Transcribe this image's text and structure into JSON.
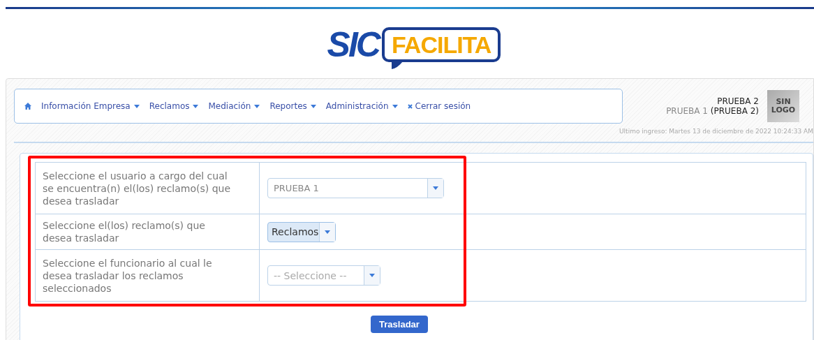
{
  "logo": {
    "left": "SIC",
    "right": "FACILITA"
  },
  "nav": {
    "items": [
      {
        "label": "Información Empresa",
        "kind": "dropdown"
      },
      {
        "label": "Reclamos",
        "kind": "dropdown"
      },
      {
        "label": "Mediación",
        "kind": "dropdown"
      },
      {
        "label": "Reportes",
        "kind": "dropdown"
      },
      {
        "label": "Administración",
        "kind": "dropdown"
      },
      {
        "label": "Cerrar sesión",
        "kind": "logout"
      }
    ]
  },
  "user": {
    "company": "PRUEBA 2",
    "user": "PRUEBA 1",
    "role": "(PRUEBA 2)",
    "logo_text": "SIN LOGO",
    "last_login": "Ultimo ingreso: Martes 13 de diciembre de 2022 10:24:33 AM"
  },
  "form": {
    "rows": [
      {
        "label": "Seleccione el usuario a cargo del cual se encuentra(n) el(los) reclamo(s) que desea trasladar",
        "kind": "select",
        "value": "PRUEBA 1"
      },
      {
        "label": "Seleccione el(los) reclamo(s) que desea trasladar",
        "kind": "multiselect",
        "value": "Reclamos"
      },
      {
        "label": "Seleccione el funcionario al cual le desea trasladar los reclamos seleccionados",
        "kind": "select-placeholder",
        "placeholder": "-- Seleccione --"
      }
    ],
    "button": "Trasladar"
  }
}
